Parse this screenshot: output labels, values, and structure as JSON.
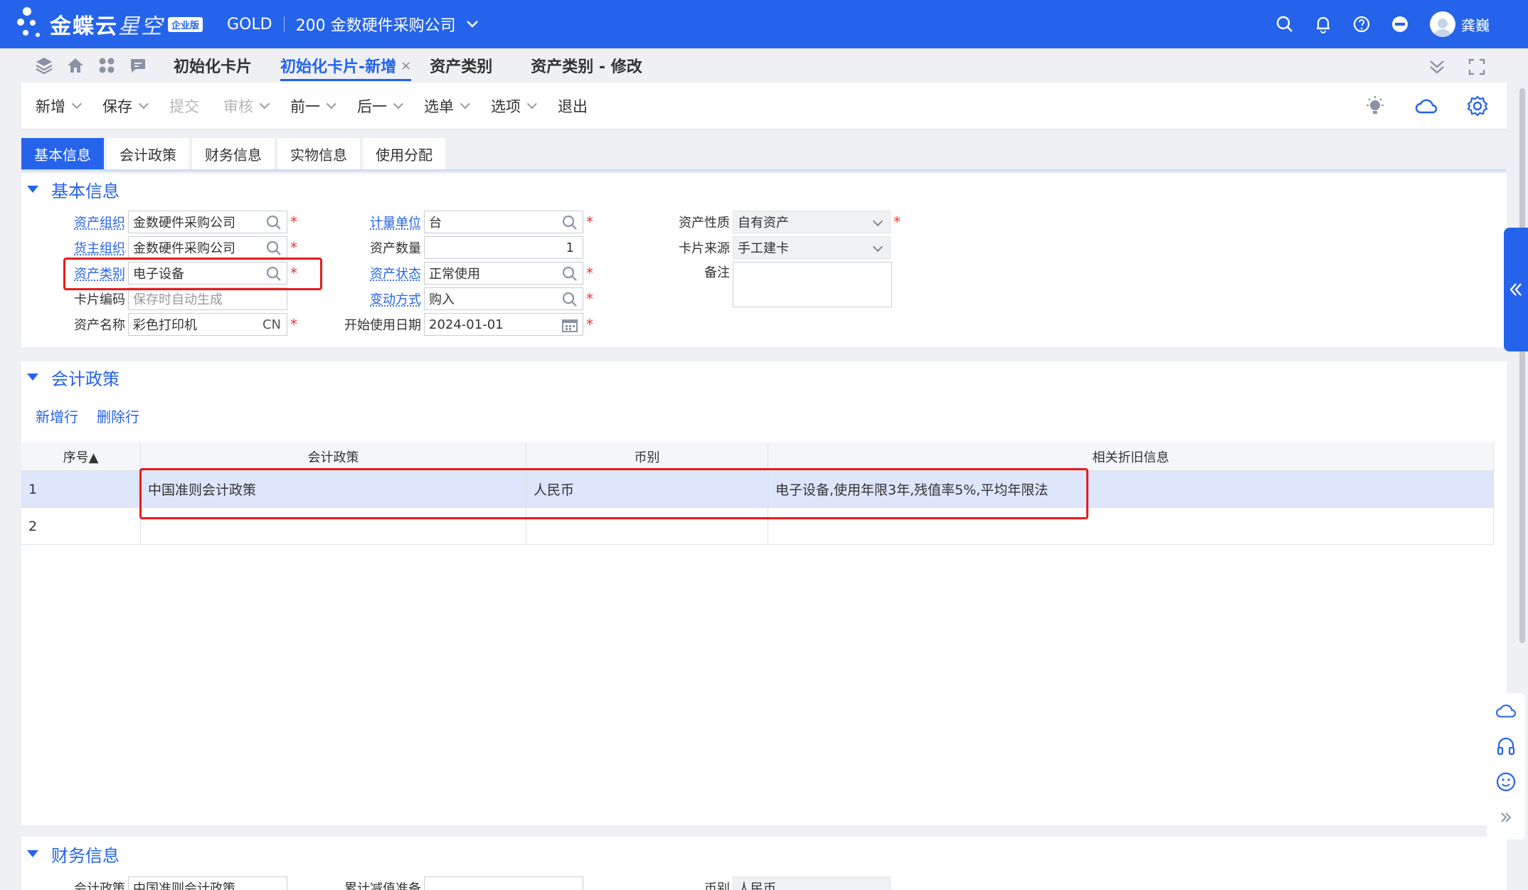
{
  "brand": {
    "name": "金蝶云",
    "product": "星空",
    "edition": "企业版"
  },
  "header": {
    "gold": "GOLD",
    "company": "200 金数硬件采购公司",
    "username": "龚巍"
  },
  "page_tabs": [
    {
      "label": "初始化卡片"
    },
    {
      "label": "初始化卡片-新增",
      "active": true
    },
    {
      "label": "资产类别"
    },
    {
      "label": "资产类别 - 修改"
    }
  ],
  "toolbar": {
    "new": "新增",
    "save": "保存",
    "submit": "提交",
    "audit": "审核",
    "prev": "前一",
    "next": "后一",
    "select": "选单",
    "options": "选项",
    "exit": "退出"
  },
  "section_tabs": [
    "基本信息",
    "会计政策",
    "财务信息",
    "实物信息",
    "使用分配"
  ],
  "basic": {
    "title": "基本信息",
    "asset_org": {
      "label": "资产组织",
      "value": "金数硬件采购公司"
    },
    "owner_org": {
      "label": "货主组织",
      "value": "金数硬件采购公司"
    },
    "asset_category": {
      "label": "资产类别",
      "value": "电子设备"
    },
    "card_code": {
      "label": "卡片编码",
      "placeholder": "保存时自动生成"
    },
    "asset_name": {
      "label": "资产名称",
      "value": "彩色打印机",
      "lang": "CN"
    },
    "unit": {
      "label": "计量单位",
      "value": "台"
    },
    "quantity": {
      "label": "资产数量",
      "value": "1"
    },
    "status": {
      "label": "资产状态",
      "value": "正常使用"
    },
    "change_method": {
      "label": "变动方式",
      "value": "购入"
    },
    "start_date": {
      "label": "开始使用日期",
      "value": "2024-01-01"
    },
    "nature": {
      "label": "资产性质",
      "value": "自有资产"
    },
    "source": {
      "label": "卡片来源",
      "value": "手工建卡"
    },
    "remark": {
      "label": "备注",
      "value": ""
    }
  },
  "accounting": {
    "title": "会计政策",
    "add_row": "新增行",
    "delete_row": "删除行",
    "columns": [
      "序号▲",
      "会计政策",
      "币别",
      "相关折旧信息"
    ],
    "rows": [
      {
        "seq": "1",
        "policy": "中国准则会计政策",
        "currency": "人民币",
        "depreciation": "电子设备,使用年限3年,残值率5%,平均年限法"
      },
      {
        "seq": "2",
        "policy": "",
        "currency": "",
        "depreciation": ""
      }
    ]
  },
  "finance": {
    "title": "财务信息",
    "f1_label": "会计政策",
    "f1_value": "中国准则会计政策",
    "f2_label": "累计减值准备",
    "f3_label": "币别",
    "f3_value": "人民币"
  },
  "colors": {
    "primary": "#2563eb",
    "highlight": "#e51c1c",
    "required": "#e53935"
  }
}
